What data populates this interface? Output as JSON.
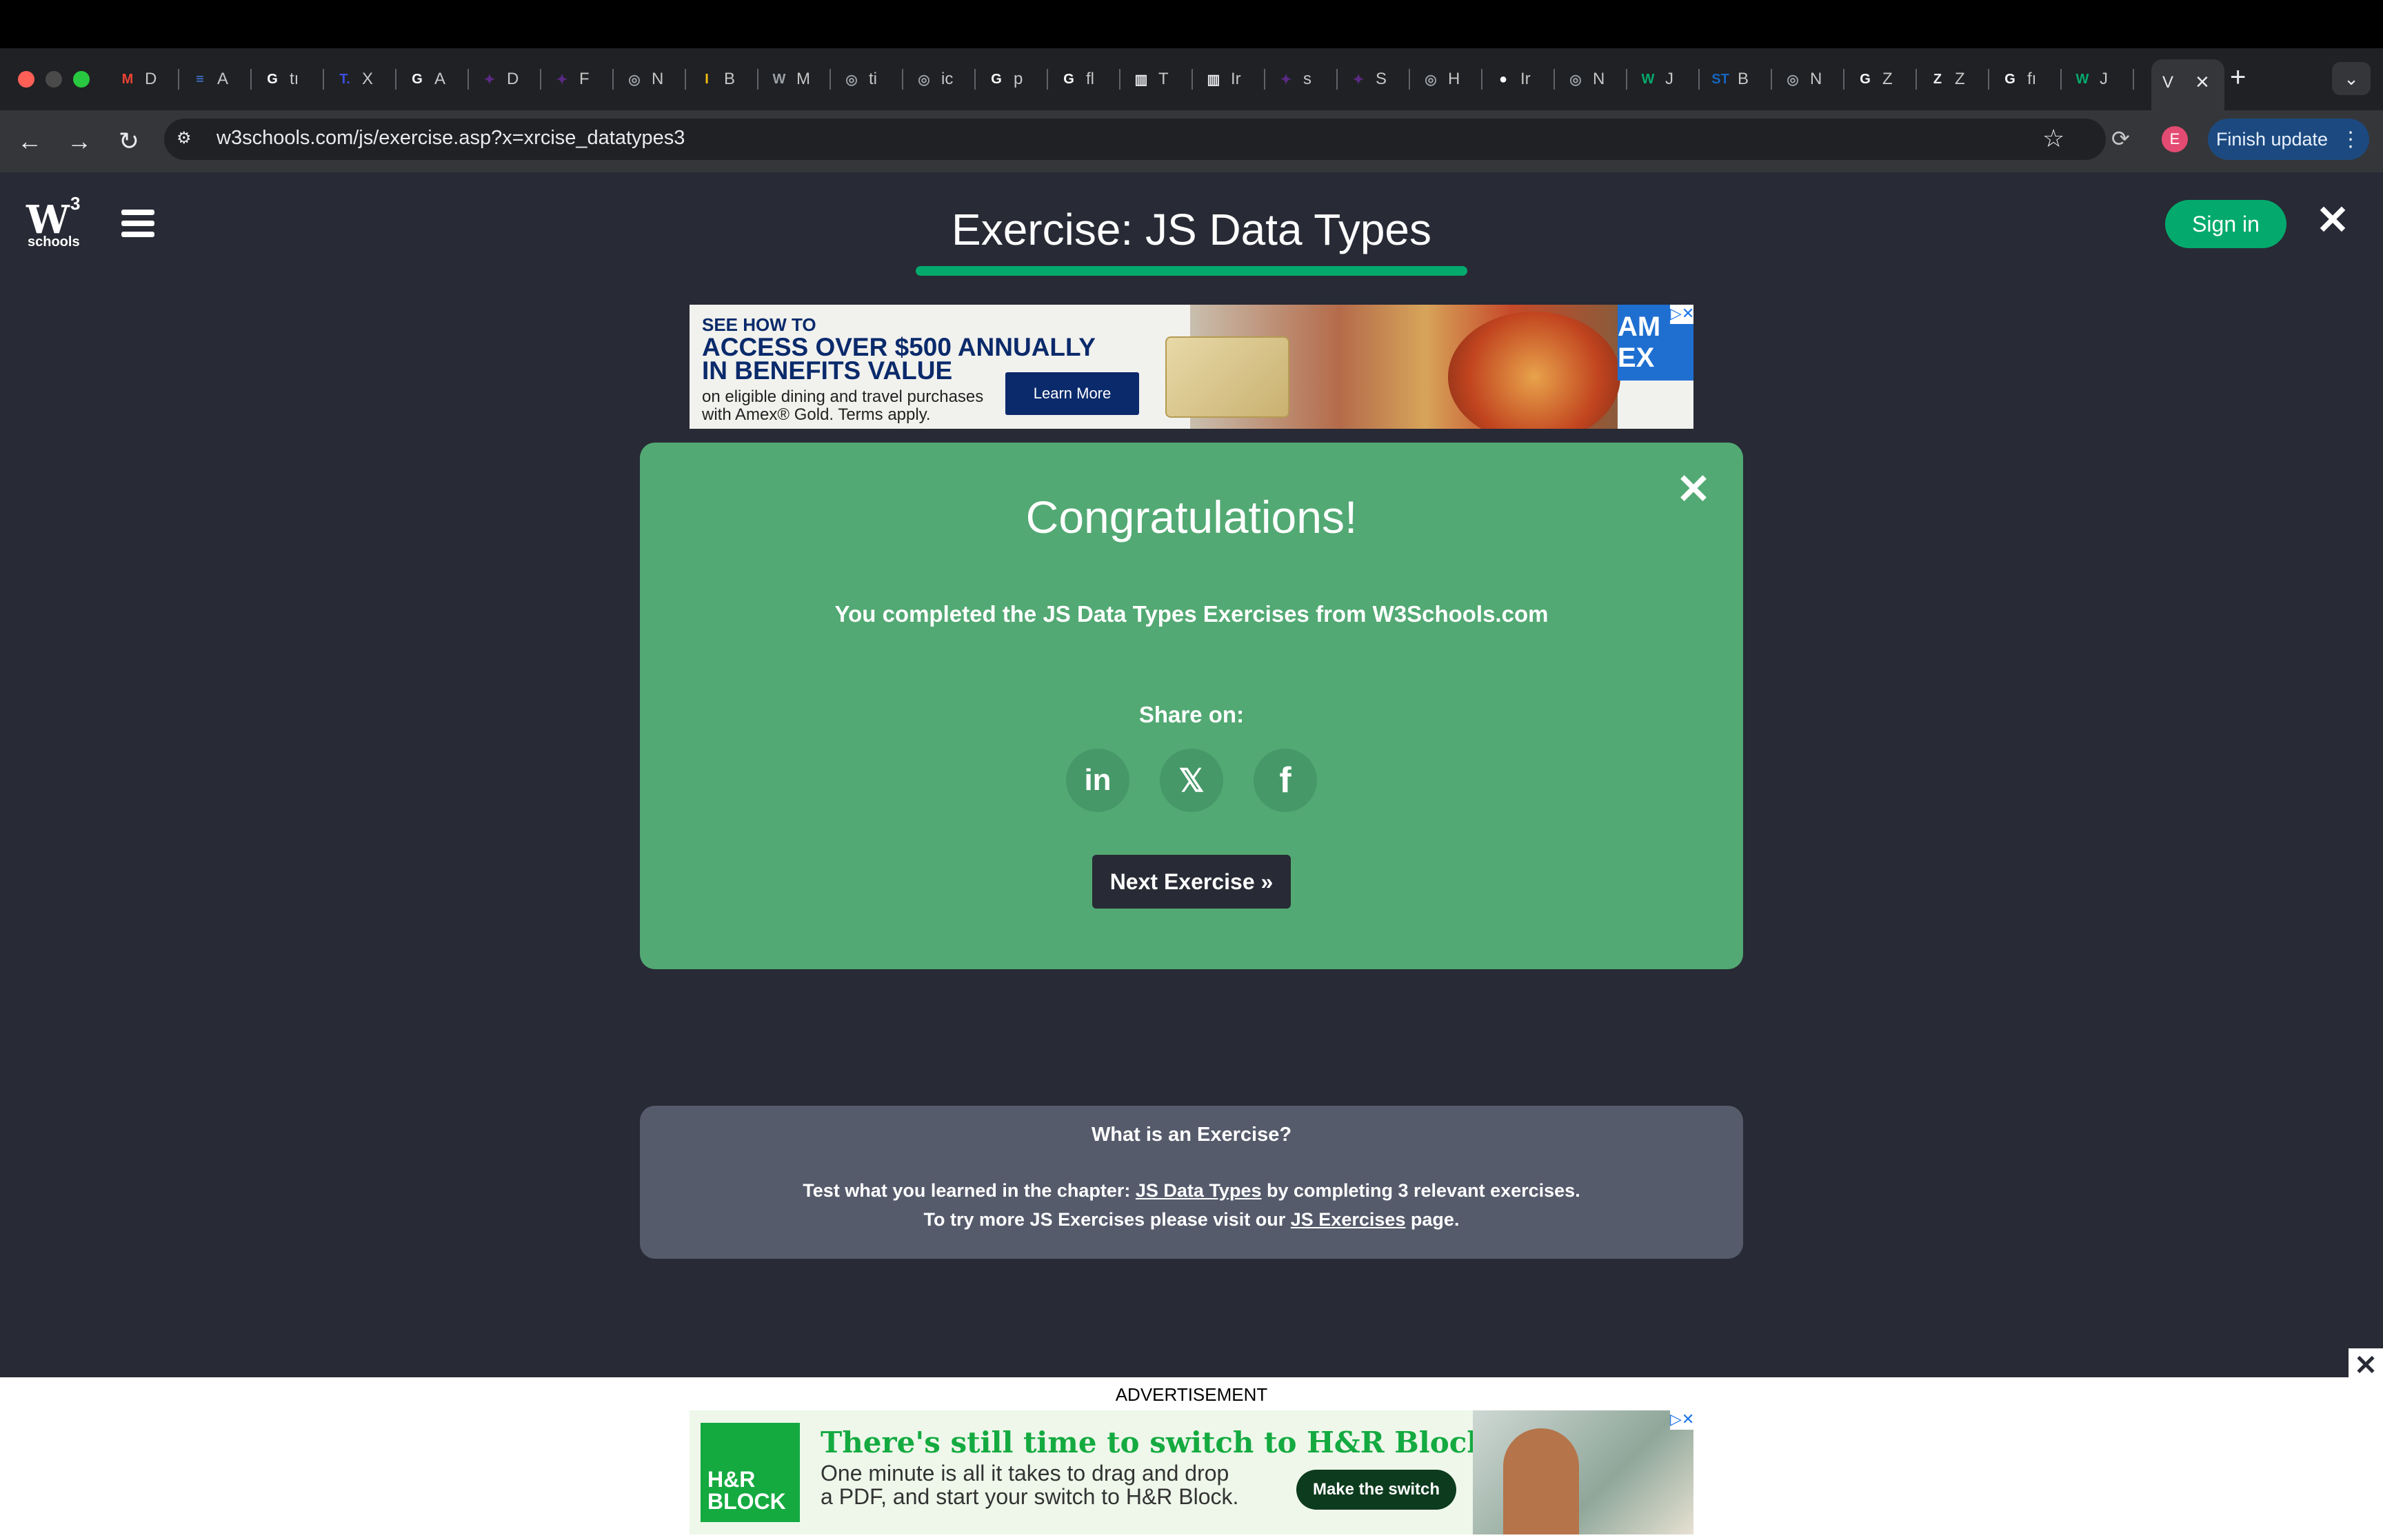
{
  "browser": {
    "tabs": [
      {
        "icon": "gmail-icon",
        "label": "D",
        "color": "#EA4335",
        "glyph": "M"
      },
      {
        "icon": "docs-icon",
        "label": "A",
        "color": "#4285F4",
        "glyph": "≡"
      },
      {
        "icon": "google-icon",
        "label": "tı",
        "color": "#ffffff",
        "glyph": "G"
      },
      {
        "icon": "t-icon",
        "label": "X",
        "color": "#3C4FE0",
        "glyph": "T."
      },
      {
        "icon": "google-icon",
        "label": "A",
        "color": "#ffffff",
        "glyph": "G"
      },
      {
        "icon": "pin-icon",
        "label": "D",
        "color": "#5B2A86",
        "glyph": "✦"
      },
      {
        "icon": "pin-icon",
        "label": "F",
        "color": "#5B2A86",
        "glyph": "✦"
      },
      {
        "icon": "globe-icon",
        "label": "N",
        "color": "#9aa0a6",
        "glyph": "◎"
      },
      {
        "icon": "i-icon",
        "label": "B",
        "color": "#F4C20D",
        "glyph": "I"
      },
      {
        "icon": "w-icon",
        "label": "M",
        "color": "#9aa0a6",
        "glyph": "W"
      },
      {
        "icon": "globe-icon",
        "label": "ti",
        "color": "#9aa0a6",
        "glyph": "◎"
      },
      {
        "icon": "globe-icon",
        "label": "ic",
        "color": "#9aa0a6",
        "glyph": "◎"
      },
      {
        "icon": "google-icon",
        "label": "p",
        "color": "#ffffff",
        "glyph": "G"
      },
      {
        "icon": "google-icon",
        "label": "fl",
        "color": "#ffffff",
        "glyph": "G"
      },
      {
        "icon": "bank-icon",
        "label": "T",
        "color": "#e8eaed",
        "glyph": "▥"
      },
      {
        "icon": "bank-icon",
        "label": "Ir",
        "color": "#e8eaed",
        "glyph": "▥"
      },
      {
        "icon": "pin-icon",
        "label": "s",
        "color": "#5B2A86",
        "glyph": "✦"
      },
      {
        "icon": "pin-icon",
        "label": "S",
        "color": "#5B2A86",
        "glyph": "✦"
      },
      {
        "icon": "globe-icon",
        "label": "H",
        "color": "#9aa0a6",
        "glyph": "◎"
      },
      {
        "icon": "github-icon",
        "label": "Ir",
        "color": "#ffffff",
        "glyph": "●"
      },
      {
        "icon": "globe-icon",
        "label": "N",
        "color": "#9aa0a6",
        "glyph": "◎"
      },
      {
        "icon": "w3-icon",
        "label": "J",
        "color": "#04AA6D",
        "glyph": "W"
      },
      {
        "icon": "st-icon",
        "label": "B",
        "color": "#1565C0",
        "glyph": "ST"
      },
      {
        "icon": "globe-icon",
        "label": "N",
        "color": "#9aa0a6",
        "glyph": "◎"
      },
      {
        "icon": "google-icon",
        "label": "Z",
        "color": "#ffffff",
        "glyph": "G"
      },
      {
        "icon": "z-icon",
        "label": "Z",
        "color": "#e8eaed",
        "glyph": "Z"
      },
      {
        "icon": "google-icon",
        "label": "fı",
        "color": "#ffffff",
        "glyph": "G"
      },
      {
        "icon": "w3-icon",
        "label": "J",
        "color": "#04AA6D",
        "glyph": "W"
      }
    ],
    "active_tab": {
      "label": "V",
      "icon": "w3-icon"
    },
    "url": "w3schools.com/js/exercise.asp?x=xrcise_datatypes3",
    "profile_initial": "E",
    "finish_update_label": "Finish update"
  },
  "header": {
    "logo_text": "W",
    "logo_superscript": "3",
    "logo_sub": "schools",
    "title": "Exercise: JS Data Types",
    "sign_in_label": "Sign in"
  },
  "ad_top": {
    "line1": "SEE HOW TO",
    "line2": "ACCESS OVER $500 ANNUALLY",
    "line3": "IN BENEFITS VALUE",
    "line4": "on eligible dining and travel purchases",
    "line5": "with Amex® Gold. Terms apply.",
    "button_label": "Learn More",
    "brand": "AM EX"
  },
  "congrats": {
    "title": "Congratulations!",
    "message": "You completed the JS Data Types Exercises from W3Schools.com",
    "share_label": "Share on:",
    "share_linkedin": "in",
    "share_x": "𝕏",
    "share_facebook": "f",
    "next_label": "Next Exercise »"
  },
  "info": {
    "title": "What is an Exercise?",
    "line1_prefix": "Test what you learned in the chapter: ",
    "line1_link": "JS Data Types",
    "line1_suffix": " by completing 3 relevant exercises.",
    "line2_prefix": "To try more JS Exercises please visit our ",
    "line2_link": "JS Exercises",
    "line2_suffix": " page."
  },
  "ad_bottom": {
    "label": "ADVERTISEMENT",
    "logo_line1": "H&R",
    "logo_line2": "BLOCK",
    "headline": "There's still time to switch to H&R Block Online.",
    "sub1": "One minute is all it takes to drag and drop",
    "sub2": "a PDF, and start your switch to H&R Block.",
    "button_label": "Make the switch"
  },
  "colors": {
    "page_bg": "#282A35",
    "accent_green": "#04AA6D",
    "card_green": "#52A973",
    "info_box": "#555B6B"
  }
}
